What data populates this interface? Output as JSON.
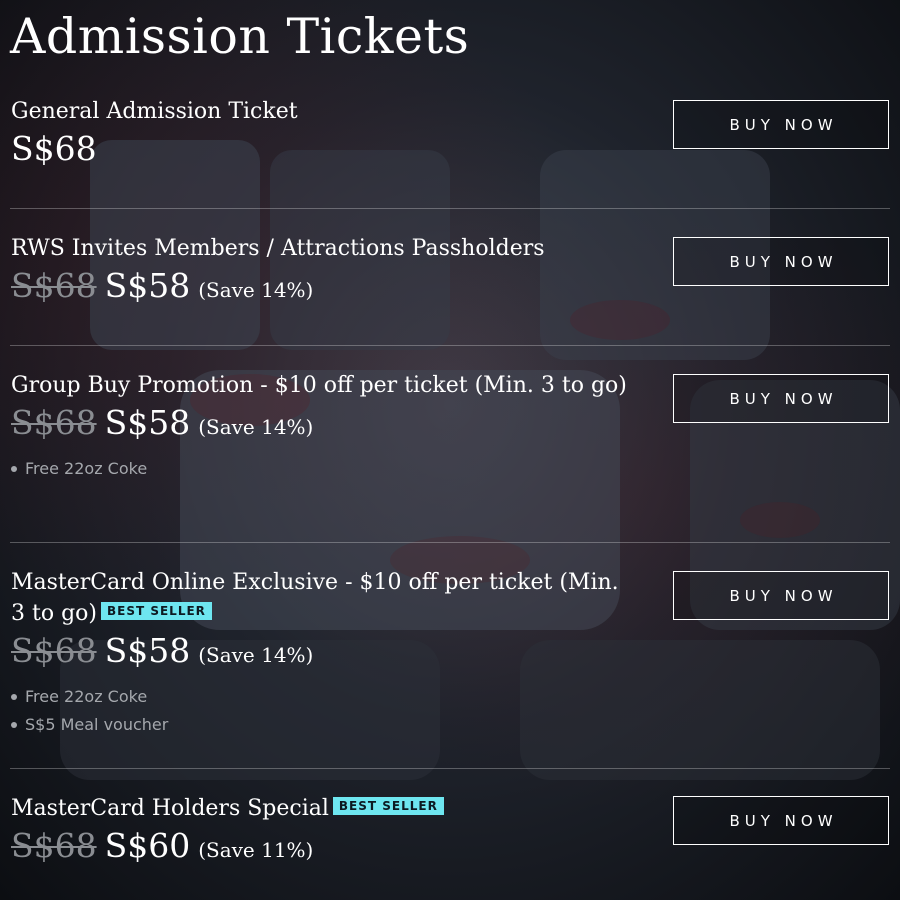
{
  "page": {
    "title": "Admission Tickets",
    "accent_color": "#6ee6f0",
    "strike_color": "#8a8d92"
  },
  "tickets": [
    {
      "name": "General Admission Ticket",
      "badge": "",
      "old_price": "",
      "price": "S$68",
      "save": "",
      "perks": [],
      "button_label": "BUY NOW"
    },
    {
      "name": "RWS Invites Members / Attractions Passholders",
      "badge": "",
      "old_price": "S$68",
      "price": "S$58",
      "save": "(Save 14%)",
      "perks": [],
      "button_label": "BUY NOW"
    },
    {
      "name": "Group Buy Promotion - $10 off per ticket (Min. 3 to go)",
      "badge": "",
      "old_price": "S$68",
      "price": "S$58",
      "save": "(Save 14%)",
      "perks": [
        "Free 22oz Coke"
      ],
      "button_label": "BUY NOW"
    },
    {
      "name": "MasterCard Online Exclusive - $10 off per ticket (Min. 3 to go)",
      "badge": "BEST SELLER",
      "old_price": "S$68",
      "price": "S$58",
      "save": "(Save 14%)",
      "perks": [
        "Free 22oz Coke",
        "S$5 Meal voucher"
      ],
      "button_label": "BUY NOW"
    },
    {
      "name": "MasterCard Holders Special",
      "badge": "BEST SELLER",
      "old_price": "S$68",
      "price": "S$60",
      "save": "(Save 11%)",
      "perks": [],
      "button_label": "BUY NOW"
    }
  ]
}
